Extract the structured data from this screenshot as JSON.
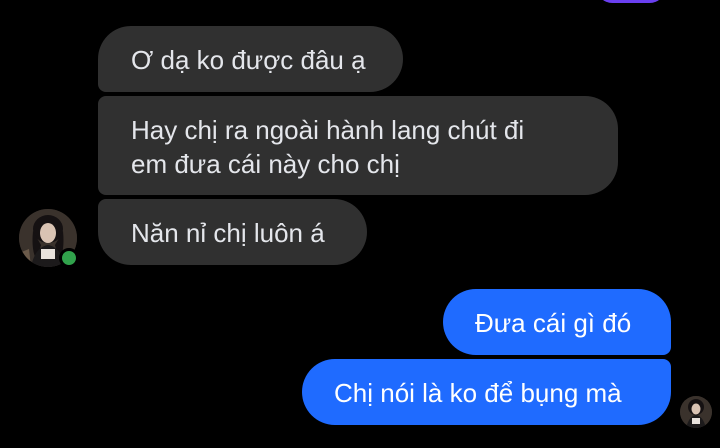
{
  "conversation": {
    "messages": [
      {
        "sender": "other",
        "text": "Ơ dạ ko được đâu ạ"
      },
      {
        "sender": "other",
        "text": "Hay chị ra ngoài hành lang chút đi\nem đưa cái này cho chị"
      },
      {
        "sender": "other",
        "text": "Năn nỉ chị luôn á"
      },
      {
        "sender": "me",
        "text": "Đưa cái gì đó"
      },
      {
        "sender": "me",
        "text": "Chị nói là ko để bụng mà"
      }
    ]
  },
  "colors": {
    "background": "#000000",
    "incoming_bubble": "#303030",
    "outgoing_bubble": "#1f6bff",
    "previous_bubble": "#6a3ff0",
    "online_status": "#31a24c"
  },
  "icons": {
    "contact_avatar": "avatar-photo",
    "online_indicator": "online-dot",
    "read_receipt": "seen-avatar"
  }
}
